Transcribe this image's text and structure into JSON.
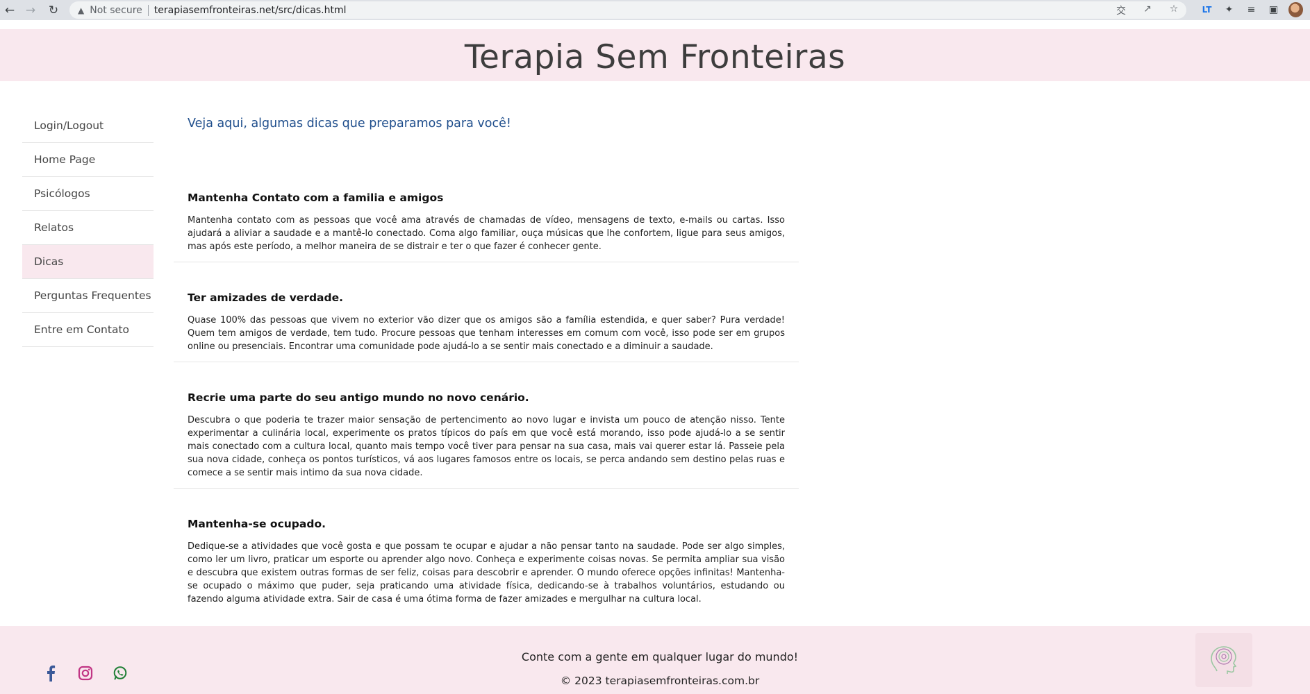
{
  "browser": {
    "not_secure": "Not secure",
    "url": "terapiasemfronteiras.net/src/dicas.html"
  },
  "header": {
    "title": "Terapia Sem Fronteiras"
  },
  "sidebar": {
    "items": [
      {
        "label": "Login/Logout"
      },
      {
        "label": "Home Page"
      },
      {
        "label": "Psicólogos"
      },
      {
        "label": "Relatos"
      },
      {
        "label": "Dicas"
      },
      {
        "label": "Perguntas Frequentes"
      },
      {
        "label": "Entre em Contato"
      }
    ],
    "active": "Dicas"
  },
  "main": {
    "intro": "Veja aqui, algumas dicas que preparamos para você!",
    "tips": [
      {
        "title": "Mantenha Contato com a familia e amigos",
        "text": "Mantenha contato com as pessoas que você ama através de chamadas de vídeo, mensagens de texto, e-mails ou cartas. Isso ajudará a aliviar a saudade e a mantê-lo conectado. Coma algo familiar, ouça músicas que lhe confortem, ligue para seus amigos, mas após este período, a melhor maneira de se distrair e ter o que fazer é conhecer gente."
      },
      {
        "title": "Ter amizades de verdade.",
        "text": "Quase 100% das pessoas que vivem no exterior vão dizer que os amigos são a família estendida, e quer saber? Pura verdade! Quem tem amigos de verdade, tem tudo. Procure pessoas que tenham interesses em comum com você, isso pode ser em grupos online ou presenciais. Encontrar uma comunidade pode ajudá-lo a se sentir mais conectado e a diminuir a saudade."
      },
      {
        "title": "Recrie uma parte do seu antigo mundo no novo cenário.",
        "text": "Descubra o que poderia te trazer maior sensação de pertencimento ao novo lugar e invista um pouco de atenção nisso. Tente experimentar a culinária local, experimente os pratos típicos do país em que você está morando, isso pode ajudá-lo a se sentir mais conectado com a cultura local, quanto mais tempo você tiver para pensar na sua casa, mais vai querer estar lá. Passeie pela sua nova cidade, conheça os pontos turísticos, vá aos lugares famosos entre os locais, se perca andando sem destino pelas ruas e comece a se sentir mais intimo da sua nova cidade."
      },
      {
        "title": "Mantenha-se ocupado.",
        "text": "Dedique-se a atividades que você gosta e que possam te ocupar e ajudar a não pensar tanto na saudade. Pode ser algo simples, como ler um livro, praticar um esporte ou aprender algo novo. Conheça e experimente coisas novas. Se permita ampliar sua visão e descubra que existem outras formas de ser feliz, coisas para descobrir e aprender. O mundo oferece opções infinitas! Mantenha-se ocupado o máximo que puder, seja praticando uma atividade física, dedicando-se à trabalhos voluntários, estudando ou fazendo alguma atividade extra. Sair de casa é uma ótima forma de fazer amizades e mergulhar na cultura local."
      }
    ]
  },
  "footer": {
    "tagline": "Conte com a gente em qualquer lugar do mundo!",
    "copyright": "© 2023 terapiasemfronteiras.com.br"
  },
  "colors": {
    "header_bg": "#f9e8ee",
    "intro_text": "#1f4e8c",
    "facebook": "#3b5998",
    "instagram": "#c13584",
    "whatsapp": "#1e7e34"
  },
  "icons": [
    "back-arrow-icon",
    "forward-arrow-icon",
    "reload-icon",
    "warning-icon",
    "translate-icon",
    "share-icon",
    "star-icon",
    "extension-icon",
    "puzzle-icon",
    "reading-list-icon",
    "sidepanel-icon",
    "profile-avatar",
    "facebook-icon",
    "instagram-icon",
    "whatsapp-icon",
    "site-logo"
  ]
}
